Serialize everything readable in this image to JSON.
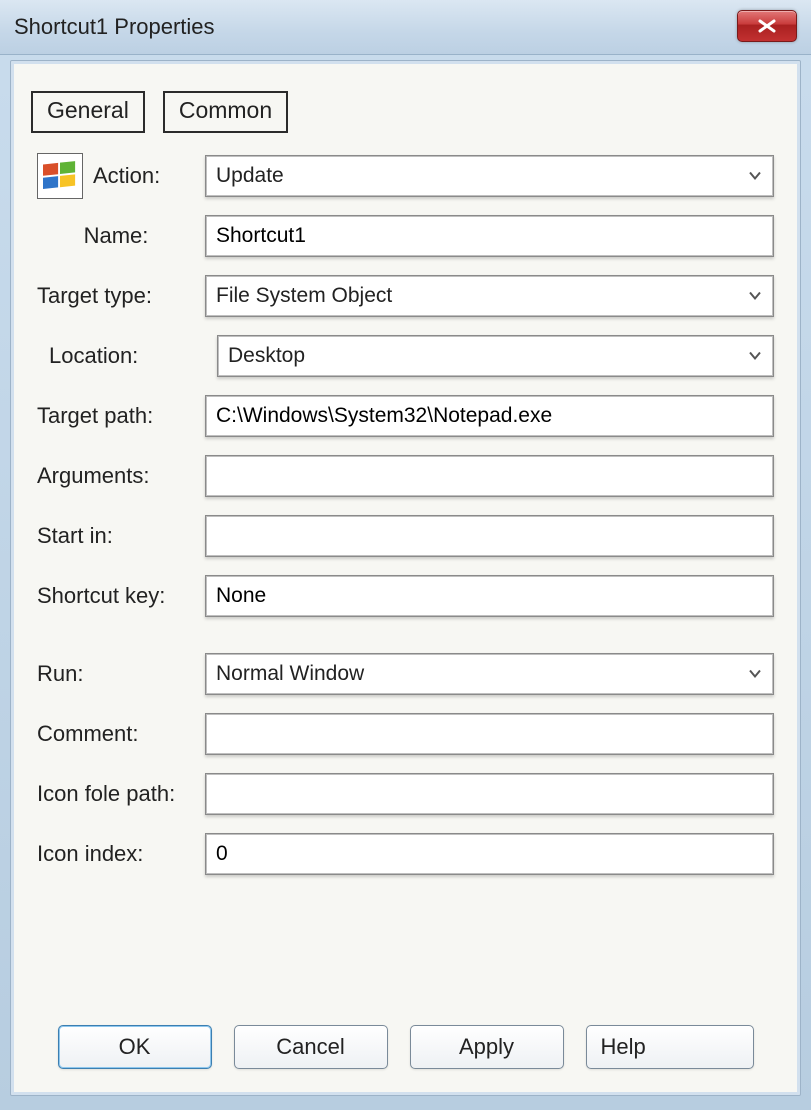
{
  "window": {
    "title": "Shortcut1 Properties"
  },
  "tabs": {
    "general": "General",
    "common": "Common"
  },
  "labels": {
    "action": "Action:",
    "name": "Name:",
    "target_type": "Target type:",
    "location": "Location:",
    "target_path": "Target path:",
    "arguments": "Arguments:",
    "start_in": "Start in:",
    "shortcut_key": "Shortcut key:",
    "run": "Run:",
    "comment": "Comment:",
    "icon_file_path": "Icon fole path:",
    "icon_index": "Icon index:"
  },
  "values": {
    "action": "Update",
    "name": "Shortcut1",
    "target_type": "File System Object",
    "location": "Desktop",
    "target_path": "C:\\Windows\\System32\\Notepad.exe",
    "arguments": "",
    "start_in": "",
    "shortcut_key": "None",
    "run": "Normal Window",
    "comment": "",
    "icon_file_path": "",
    "icon_index": "0"
  },
  "buttons": {
    "ok": "OK",
    "cancel": "Cancel",
    "apply": "Apply",
    "help": "Help"
  }
}
